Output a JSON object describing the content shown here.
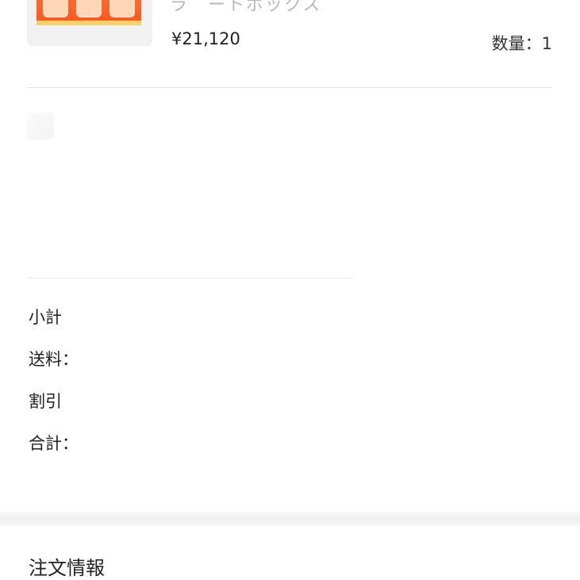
{
  "product": {
    "title": "ラ゛ートボックス",
    "price": "¥21,120",
    "quantity": "数量：1"
  },
  "summary": {
    "subtotal_label": "小計",
    "shipping_label": "送料：",
    "discount_label": "割引",
    "total_label": "合計："
  },
  "order_info": {
    "title": "注文情報"
  },
  "colors": {
    "box_orange": "#ff5a1e",
    "box_yellow": "#f6d36a"
  }
}
